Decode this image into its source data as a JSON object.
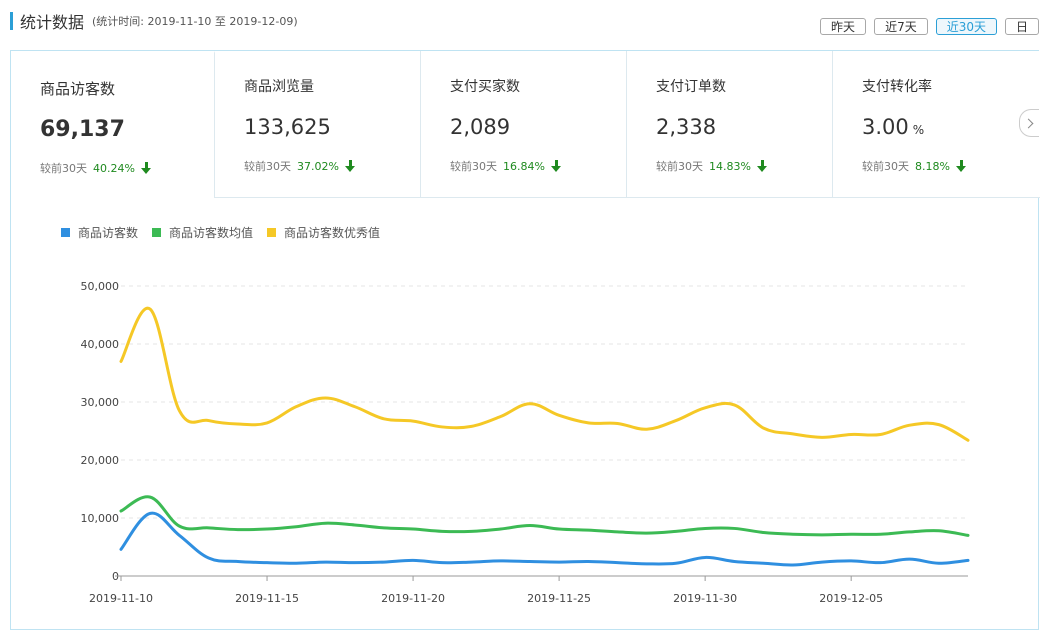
{
  "header": {
    "title": "统计数据",
    "subtitle": "(统计时间: 2019-11-10 至 2019-12-09)",
    "buttons": [
      {
        "label": "昨天",
        "active": false
      },
      {
        "label": "近7天",
        "active": false
      },
      {
        "label": "近30天",
        "active": true
      },
      {
        "label": "日",
        "active": false
      }
    ]
  },
  "kpis": [
    {
      "label": "商品访客数",
      "value": "69,137",
      "unit": "",
      "compare_label": "较前30天",
      "pct": "40.24%",
      "selected": true
    },
    {
      "label": "商品浏览量",
      "value": "133,625",
      "unit": "",
      "compare_label": "较前30天",
      "pct": "37.02%",
      "selected": false
    },
    {
      "label": "支付买家数",
      "value": "2,089",
      "unit": "",
      "compare_label": "较前30天",
      "pct": "16.84%",
      "selected": false
    },
    {
      "label": "支付订单数",
      "value": "2,338",
      "unit": "",
      "compare_label": "较前30天",
      "pct": "14.83%",
      "selected": false
    },
    {
      "label": "支付转化率",
      "value": "3.00",
      "unit": "%",
      "compare_label": "较前30天",
      "pct": "8.18%",
      "selected": false
    }
  ],
  "icons": {
    "trend": "arrow-down-icon",
    "next": "chevron-right-icon"
  },
  "colors": {
    "accent": "#2b9fd6",
    "down": "#1f8a1f",
    "series_blue": "#2f8fe0",
    "series_green": "#3cba54",
    "series_yellow": "#f5c826"
  },
  "chart_data": {
    "type": "line",
    "legend_position": "top-left",
    "grid": true,
    "x": [
      "2019-11-10",
      "2019-11-11",
      "2019-11-12",
      "2019-11-13",
      "2019-11-14",
      "2019-11-15",
      "2019-11-16",
      "2019-11-17",
      "2019-11-18",
      "2019-11-19",
      "2019-11-20",
      "2019-11-21",
      "2019-11-22",
      "2019-11-23",
      "2019-11-24",
      "2019-11-25",
      "2019-11-26",
      "2019-11-27",
      "2019-11-28",
      "2019-11-29",
      "2019-11-30",
      "2019-12-01",
      "2019-12-02",
      "2019-12-03",
      "2019-12-04",
      "2019-12-05",
      "2019-12-06",
      "2019-12-07",
      "2019-12-08",
      "2019-12-09"
    ],
    "x_tick_labels": [
      "2019-11-10",
      "2019-11-15",
      "2019-11-20",
      "2019-11-25",
      "2019-11-30",
      "2019-12-05"
    ],
    "y_ticks": [
      "0",
      "10,000",
      "20,000",
      "30,000",
      "40,000",
      "50,000"
    ],
    "ylim": [
      0,
      50000
    ],
    "series": [
      {
        "name": "商品访客数",
        "color": "#2f8fe0",
        "values": [
          4600,
          10800,
          7000,
          3100,
          2500,
          2300,
          2200,
          2400,
          2300,
          2400,
          2700,
          2300,
          2400,
          2600,
          2500,
          2400,
          2500,
          2300,
          2100,
          2200,
          3200,
          2500,
          2200,
          1900,
          2400,
          2600,
          2300,
          2900,
          2200,
          2700
        ]
      },
      {
        "name": "商品访客数均值",
        "color": "#3cba54",
        "values": [
          11200,
          13600,
          8600,
          8300,
          8000,
          8100,
          8500,
          9100,
          8800,
          8300,
          8100,
          7700,
          7700,
          8100,
          8700,
          8100,
          7900,
          7600,
          7400,
          7700,
          8200,
          8200,
          7500,
          7200,
          7100,
          7200,
          7200,
          7600,
          7800,
          7000
        ]
      },
      {
        "name": "商品访客数优秀值",
        "color": "#f5c826",
        "values": [
          37000,
          46000,
          28500,
          26800,
          26200,
          26400,
          29200,
          30700,
          29200,
          27100,
          26700,
          25700,
          25800,
          27500,
          29700,
          27700,
          26400,
          26300,
          25300,
          26800,
          29000,
          29500,
          25500,
          24500,
          23900,
          24400,
          24400,
          26000,
          26100,
          23400
        ]
      }
    ]
  }
}
